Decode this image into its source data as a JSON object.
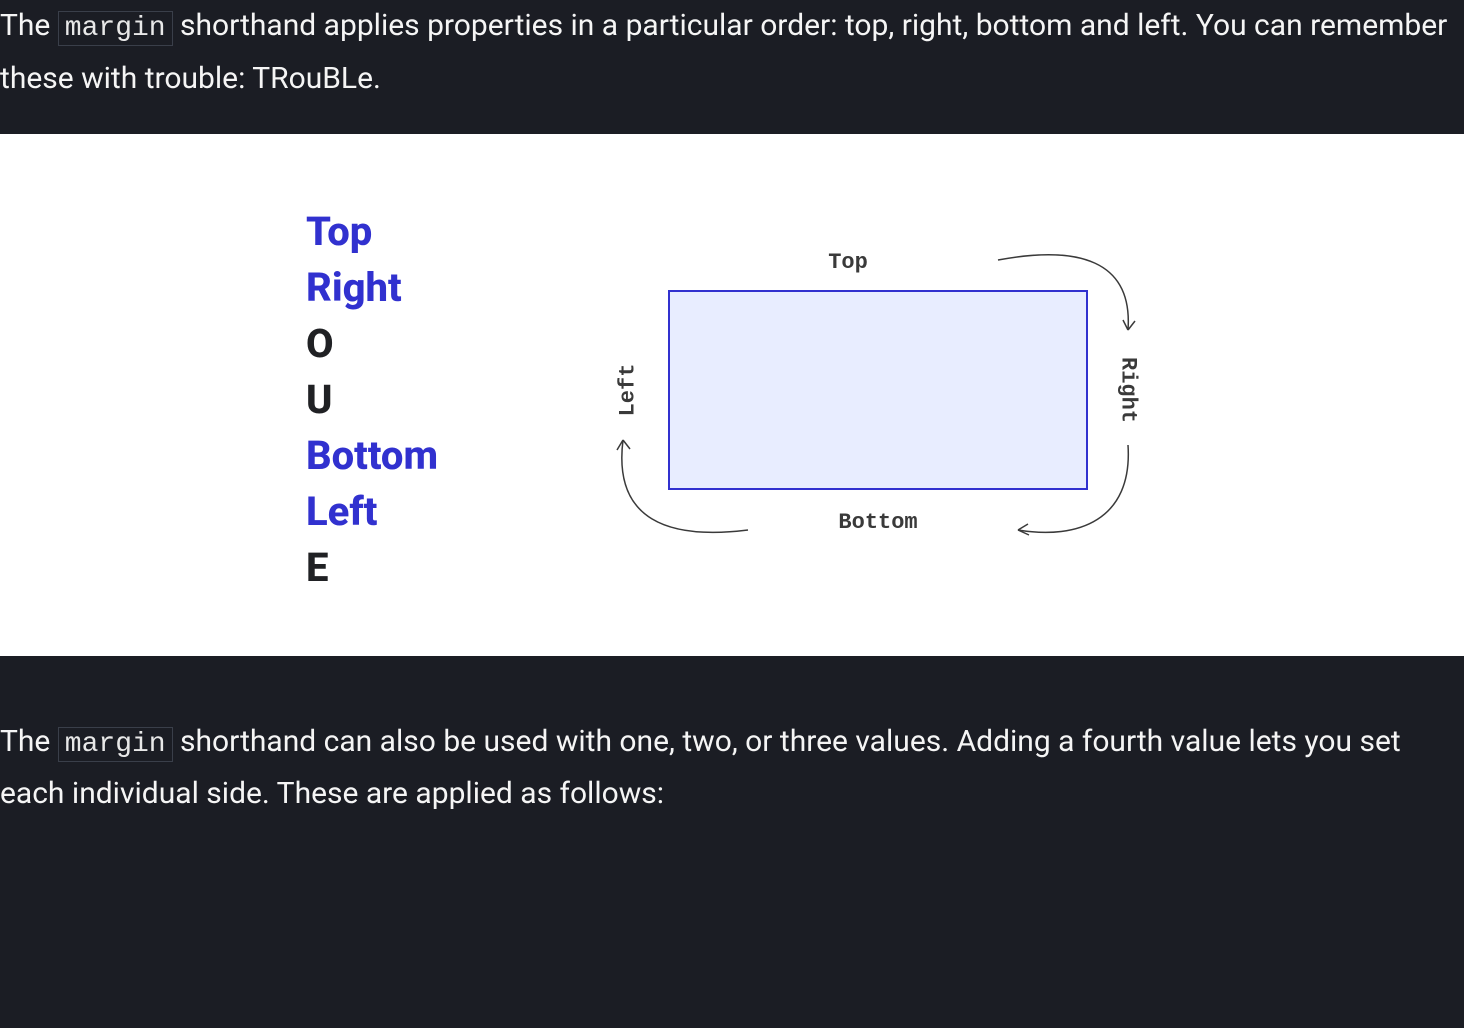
{
  "paragraph1": {
    "pre": "The ",
    "code": "margin",
    "post": " shorthand applies properties in a particular order: top, right, bottom and left. You can remember these with trouble: TRouBLe."
  },
  "trouble": {
    "items": [
      {
        "text": "Top",
        "kind": "word"
      },
      {
        "text": "Right",
        "kind": "word"
      },
      {
        "text": "O",
        "kind": "letter"
      },
      {
        "text": "U",
        "kind": "letter"
      },
      {
        "text": "Bottom",
        "kind": "word"
      },
      {
        "text": "Left",
        "kind": "word"
      },
      {
        "text": "E",
        "kind": "letter"
      }
    ]
  },
  "diagram": {
    "labels": {
      "top": "Top",
      "right": "Right",
      "bottom": "Bottom",
      "left": "Left"
    }
  },
  "paragraph2": {
    "pre": "The ",
    "code": "margin",
    "post": " shorthand can also be used with one, two, or three values. Adding a fourth value lets you set each individual side. These are applied as follows:"
  }
}
